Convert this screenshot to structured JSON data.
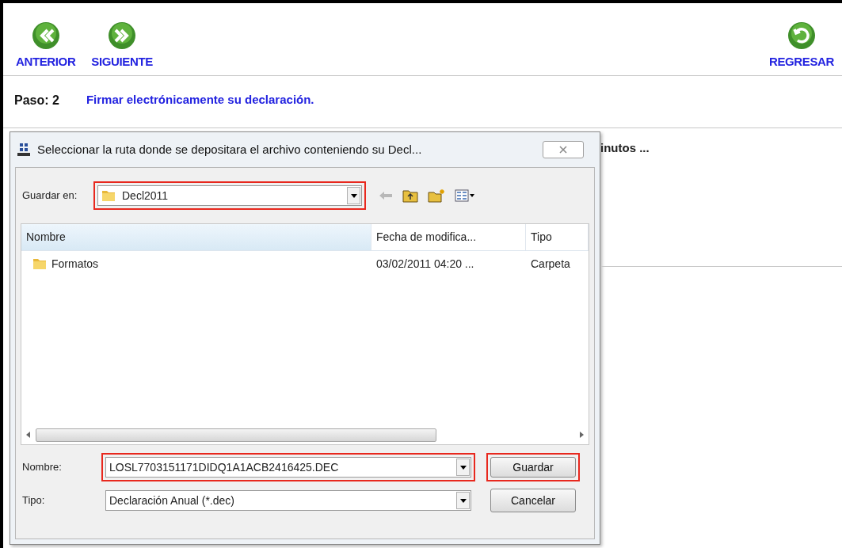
{
  "toolbar": {
    "buttons": [
      {
        "label": "ANTERIOR",
        "kind": "back"
      },
      {
        "label": "SIGUIENTE",
        "kind": "forward"
      }
    ],
    "return_button": {
      "label": "REGRESAR"
    }
  },
  "step": {
    "label": "Paso: 2",
    "title": "Firmar electrónicamente su declaración."
  },
  "background_message": "inutos ...",
  "dialog": {
    "title": "Seleccionar la ruta donde se depositara el archivo conteniendo su Decl...",
    "save_in": {
      "label": "Guardar en:",
      "value": "Decl2011",
      "highlighted": true
    },
    "columns": [
      {
        "label": "Nombre",
        "sorted": true
      },
      {
        "label": "Fecha de modifica...",
        "sorted": false
      },
      {
        "label": "Tipo",
        "sorted": false
      }
    ],
    "rows": [
      {
        "cells": [
          "Formatos",
          "03/02/2011 04:20 ...",
          "Carpeta"
        ]
      }
    ],
    "file_name": {
      "label": "Nombre:",
      "value": "LOSL7703151171DIDQ1A1ACB2416425.DEC",
      "highlighted": true
    },
    "file_type": {
      "label": "Tipo:",
      "value": "Declaración Anual (*.dec)",
      "highlighted": false
    },
    "buttons": [
      {
        "label": "Guardar",
        "highlighted": true
      },
      {
        "label": "Cancelar",
        "highlighted": false
      }
    ]
  }
}
